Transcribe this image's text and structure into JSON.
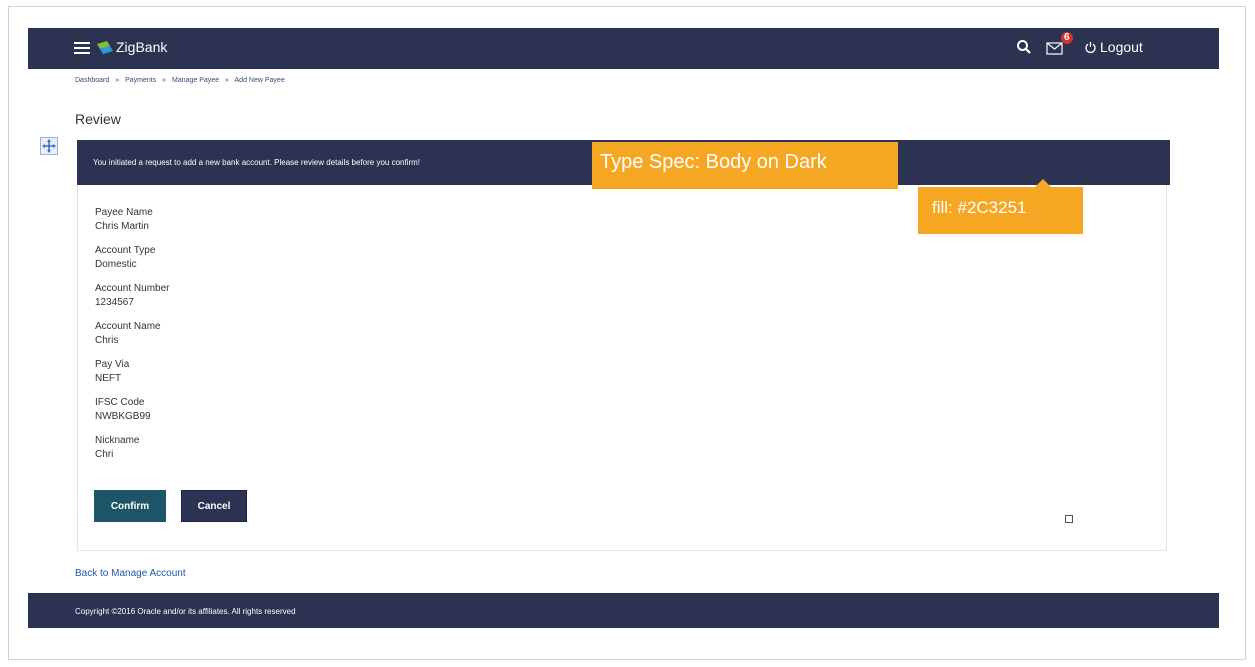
{
  "header": {
    "brand": "ZigBank",
    "notification_count": "6",
    "logout_label": "Logout"
  },
  "breadcrumb": {
    "items": [
      "Dashboard",
      "Payments",
      "Manage Payee",
      "Add New Payee"
    ],
    "separator": "»"
  },
  "page_title": "Review",
  "banner": {
    "message": "You initiated a request to add a new bank account. Please review details before you confirm!"
  },
  "details": [
    {
      "label": "Payee Name",
      "value": "Chris Martin"
    },
    {
      "label": "Account Type",
      "value": "Domestic"
    },
    {
      "label": "Account Number",
      "value": "1234567"
    },
    {
      "label": "Account Name",
      "value": "Chris"
    },
    {
      "label": "Pay Via",
      "value": "NEFT"
    },
    {
      "label": "IFSC Code",
      "value": "NWBKGB99"
    },
    {
      "label": "Nickname",
      "value": "Chri"
    }
  ],
  "actions": {
    "confirm_label": "Confirm",
    "cancel_label": "Cancel"
  },
  "back_link": "Back to Manage Account",
  "footer": {
    "copyright": "Copyright ©2016 Oracle and/or its affiliates. All rights reserved"
  },
  "annotations": {
    "type_spec": "Type Spec: Body on Dark",
    "fill_spec": "fill: #2C3251"
  },
  "colors": {
    "brand_dark": "#2C3251",
    "confirm_button": "#1D5566",
    "annotation": "#F5A623",
    "link": "#1A5AA8"
  }
}
